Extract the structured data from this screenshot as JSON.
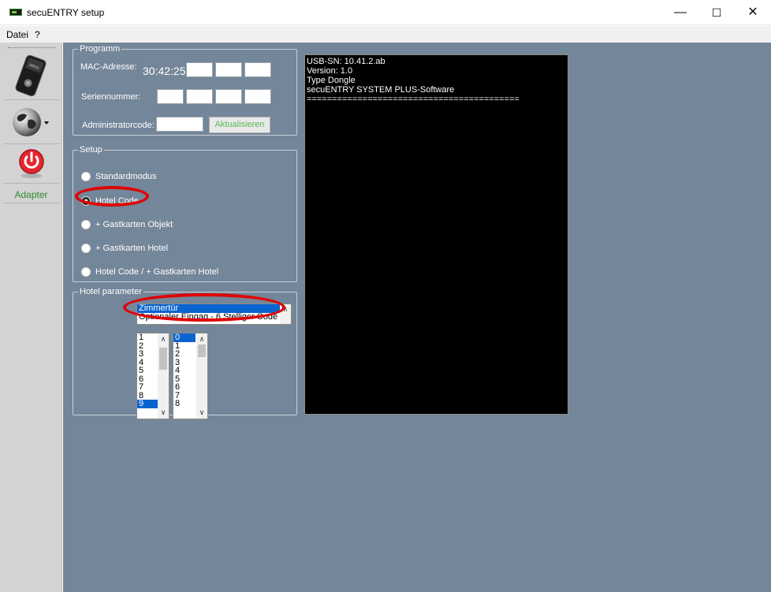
{
  "window": {
    "title": "secuENTRY setup",
    "controls": {
      "minimize": "—",
      "maximize": "☐",
      "close": "✕"
    }
  },
  "menu": {
    "items": [
      "Datei",
      "?"
    ]
  },
  "toolbar": {
    "buttons": [
      {
        "name": "dongle-device",
        "icon": "dongle-icon"
      },
      {
        "name": "language",
        "icon": "globe-icon"
      },
      {
        "name": "power",
        "icon": "power-icon"
      }
    ],
    "adapter_label": "Adapter"
  },
  "programm": {
    "legend": "Programm",
    "mac_label": "MAC-Adresse:",
    "mac_prefix": "30:42:25",
    "serial_label": "Seriennummer:",
    "admin_label": "Administratorcode:",
    "update_button": "Aktualisieren"
  },
  "setup": {
    "legend": "Setup",
    "options": [
      {
        "label": "Standardmodus",
        "checked": false
      },
      {
        "label": "Hotel Code",
        "checked": true
      },
      {
        "label": "+ Gastkarten Objekt",
        "checked": false
      },
      {
        "label": "+ Gastkarten Hotel",
        "checked": false
      },
      {
        "label": "Hotel Code / + Gastkarten Hotel",
        "checked": false
      }
    ]
  },
  "hotel_parameter": {
    "legend": "Hotel parameter",
    "type_list": [
      "Zimmertür",
      "Optionaler Eingag - 6 Stelliger Code"
    ],
    "type_selected": 0,
    "list_a": [
      "1",
      "2",
      "3",
      "4",
      "5",
      "6",
      "7",
      "8",
      "9"
    ],
    "list_a_selected": 8,
    "list_b": [
      "0",
      "1",
      "2",
      "3",
      "4",
      "5",
      "6",
      "7",
      "8"
    ],
    "list_b_selected": 0
  },
  "console": {
    "lines": [
      "USB-SN: 10.41.2.ab",
      "Version: 1.0",
      "Type Dongle",
      "secuENTRY SYSTEM PLUS-Software",
      "=========================================="
    ]
  },
  "colors": {
    "background": "#748699",
    "toolbar": "#d3d3d3",
    "highlight": "#e00000",
    "console_bg": "#000000",
    "adapter_text": "#2e8b2e"
  }
}
